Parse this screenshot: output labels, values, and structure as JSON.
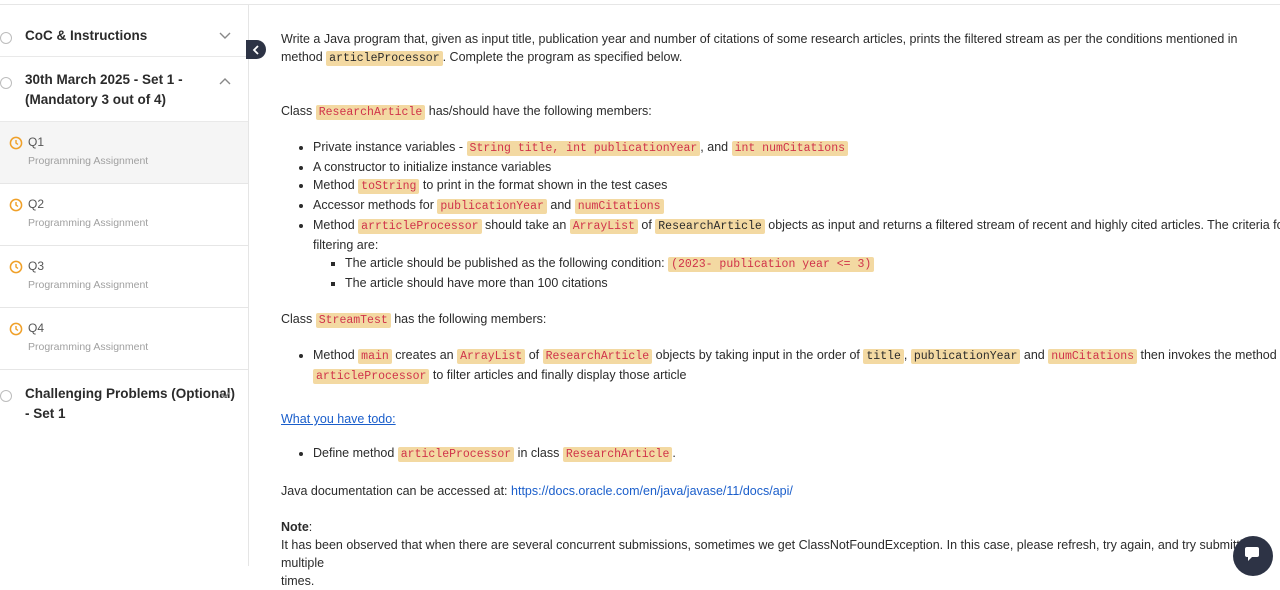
{
  "sidebar": {
    "sections": [
      {
        "title": "CoC & Instructions"
      },
      {
        "title_line1": "30th March 2025 - Set 1 -",
        "title_line2": "(Mandatory 3 out of 4)"
      },
      {
        "title_line1": "Challenging Problems (Optional)",
        "title_line2": "- Set 1"
      }
    ],
    "questions": [
      {
        "label": "Q1",
        "sub": "Programming Assignment"
      },
      {
        "label": "Q2",
        "sub": "Programming Assignment"
      },
      {
        "label": "Q3",
        "sub": "Programming Assignment"
      },
      {
        "label": "Q4",
        "sub": "Programming Assignment"
      }
    ]
  },
  "content": {
    "intro_a": "Write a Java program that, given as input title, publication year and number of citations of some research articles, prints the filtered stream as per the conditions mentioned in",
    "intro_b": "method ",
    "intro_code": "articleProcessor",
    "intro_c": ". Complete the program as specified below.",
    "class1_a": "Class ",
    "class1_code": "ResearchArticle",
    "class1_b": " has/should have the following members:",
    "b1_a": "Private instance variables - ",
    "b1_code1": "String title, int publicationYear",
    "b1_b": ", and ",
    "b1_code2": "int numCitations",
    "b2": "A constructor to initialize instance variables",
    "b3_a": "Method ",
    "b3_code": "toString",
    "b3_b": " to print in the format shown in the test cases",
    "b4_a": "Accessor methods for ",
    "b4_code1": "publicationYear",
    "b4_b": " and ",
    "b4_code2": "numCitations",
    "b5_a": "Method ",
    "b5_code1": "arrticleProcessor",
    "b5_b": " should take an ",
    "b5_code2": "ArrayList",
    "b5_c": " of ",
    "b5_code3": "ResearchArticle",
    "b5_d": " objects as input and returns a filtered stream of recent and highly cited articles. The criteria for",
    "b5_e": "filtering are:",
    "s1_a": "The article should be published as the following condition: ",
    "s1_code": "(2023- publication year <= 3)",
    "s2": "The article should have more than 100 citations",
    "class2_a": "Class ",
    "class2_code": "StreamTest",
    "class2_b": " has the following members:",
    "m_a": "Method ",
    "m_code1": "main",
    "m_b": " creates an ",
    "m_code2": "ArrayList",
    "m_c": " of ",
    "m_code3": "ResearchArticle",
    "m_d": " objects by taking input in the order of ",
    "m_code4": "title",
    "m_e": ", ",
    "m_code5": "publicationYear",
    "m_f": " and ",
    "m_code6": "numCitations",
    "m_g": " then invokes the method",
    "m_code7": "articleProcessor",
    "m_h": " to filter articles and finally display those article",
    "todo_link": "What you have todo:",
    "todo_a": "Define method ",
    "todo_code1": "articleProcessor",
    "todo_b": " in class ",
    "todo_code2": "ResearchArticle",
    "todo_c": ".",
    "doc_a": "Java documentation can be accessed at: ",
    "doc_url": "https://docs.oracle.com/en/java/javase/11/docs/api/",
    "note_label": "Note",
    "note_colon": ":",
    "note_text": "It has been observed that when there are several concurrent submissions, sometimes we get ClassNotFoundException. In this case, please refresh, try again, and try submitting multiple",
    "note_text2": "times."
  },
  "colors": {
    "accent": "#f0a028",
    "code_bg": "#f3d9a2",
    "code_fg": "#d0334a",
    "link": "#1a5ecb",
    "dark": "#2d3345"
  }
}
